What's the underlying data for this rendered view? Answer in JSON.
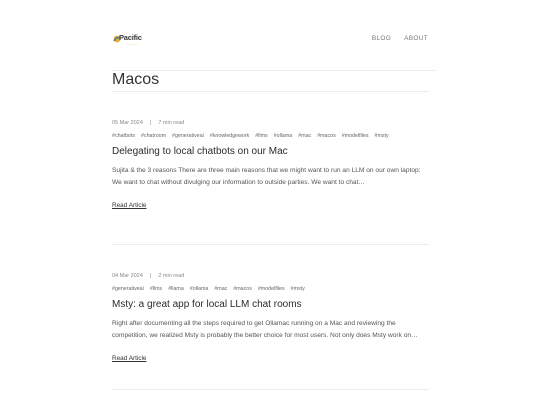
{
  "header": {
    "logo_text": "Pacific",
    "logo_sub": "·········",
    "nav": [
      {
        "label": "BLOG"
      },
      {
        "label": "ABOUT"
      }
    ]
  },
  "page_title": "Macos",
  "posts": [
    {
      "date": "05 Mar 2024",
      "separator": "|",
      "read_time": "7 min read",
      "tags": [
        "#chatbots",
        "#chatroom",
        "#generativeai",
        "#knowledgework",
        "#llms",
        "#ollama",
        "#mac",
        "#macos",
        "#modelfiles",
        "#msty"
      ],
      "title": "Delegating to local chatbots on our Mac",
      "excerpt": "Sujita & the 3 reasons There are three main reasons that we might want to run an LLM on our own laptop:  We want to chat without divulging our information to outside parties. We want to chat…",
      "read_more": "Read Article"
    },
    {
      "date": "04 Mar 2024",
      "separator": "|",
      "read_time": "2 min read",
      "tags": [
        "#generativeai",
        "#llms",
        "#llama",
        "#ollama",
        "#mac",
        "#macos",
        "#modelfiles",
        "#msty"
      ],
      "title": "Msty: a great app for local LLM chat rooms",
      "excerpt": "Right after documenting all the steps required to get Ollamac running on a Mac and reviewing the competition, we realized Msty is probably the better choice for most users. Not only does Msty work on…",
      "read_more": "Read Article"
    }
  ]
}
